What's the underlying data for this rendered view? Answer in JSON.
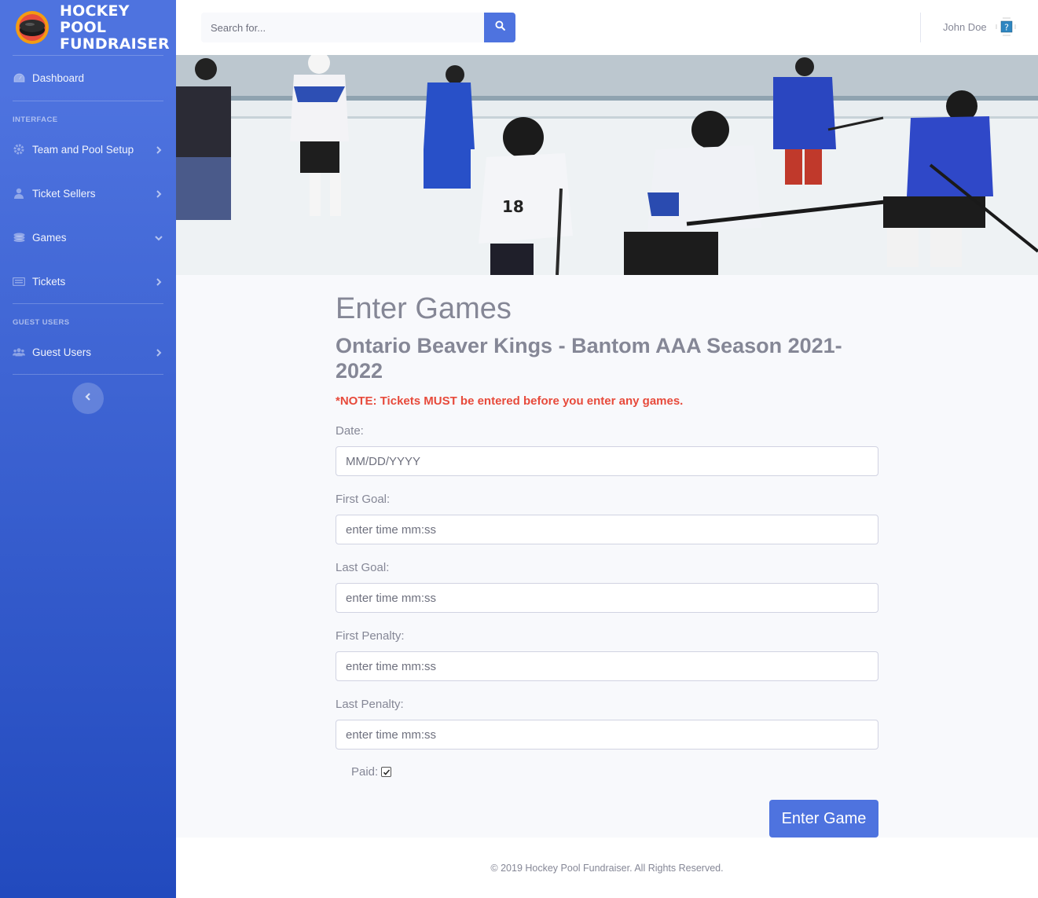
{
  "brand": {
    "line1": "HOCKEY POOL",
    "line2": "FUNDRAISER"
  },
  "sidebar": {
    "dashboard": "Dashboard",
    "interface_heading": "INTERFACE",
    "items": [
      {
        "label": "Team and Pool Setup",
        "icon": "gear-icon"
      },
      {
        "label": "Ticket Sellers",
        "icon": "user-icon"
      },
      {
        "label": "Games",
        "icon": "stack-icon"
      },
      {
        "label": "Tickets",
        "icon": "keyboard-icon"
      }
    ],
    "guest_heading": "GUEST USERS",
    "guest_label": "Guest Users"
  },
  "search": {
    "placeholder": "Search for..."
  },
  "user": {
    "name": "John Doe"
  },
  "page": {
    "title": "Enter Games",
    "subtitle": "Ontario Beaver Kings - Bantom AAA Season 2021-2022",
    "note": "*NOTE: Tickets MUST be entered before you enter any games."
  },
  "form": {
    "date_label": "Date:",
    "date_placeholder": "MM/DD/YYYY",
    "first_goal_label": "First Goal:",
    "last_goal_label": "Last Goal:",
    "first_penalty_label": "First Penalty:",
    "last_penalty_label": "Last Penalty:",
    "time_placeholder": "enter time mm:ss",
    "paid_label": "Paid:",
    "paid_checked": true,
    "submit_label": "Enter Game"
  },
  "footer": {
    "text": "© 2019 Hockey Pool Fundraiser. All Rights Reserved."
  },
  "colors": {
    "primary": "#4e73df",
    "sidebar_end": "#224abe",
    "danger": "#e74a3b",
    "text_muted": "#858796"
  }
}
